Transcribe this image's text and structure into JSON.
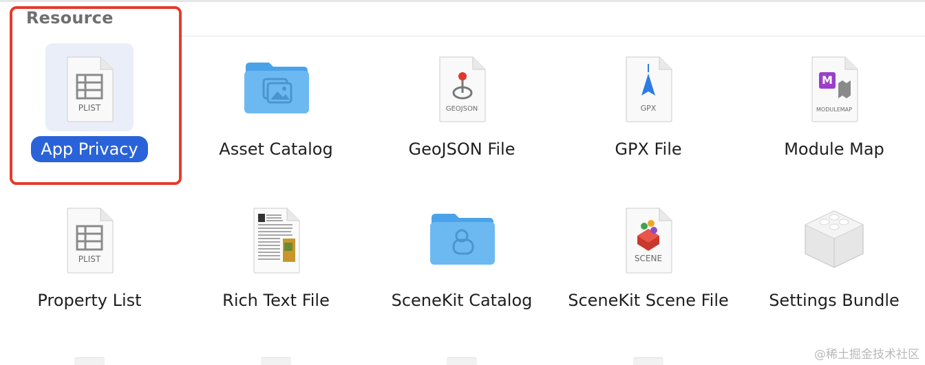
{
  "section": {
    "title": "Resource"
  },
  "templates": [
    {
      "label": "App Privacy",
      "icon": "plist-document-icon",
      "icon_text": "PLIST",
      "selected": true
    },
    {
      "label": "Asset Catalog",
      "icon": "asset-catalog-folder-icon"
    },
    {
      "label": "GeoJSON File",
      "icon": "geojson-document-icon",
      "icon_text": "GEOJSON"
    },
    {
      "label": "GPX File",
      "icon": "gpx-document-icon",
      "icon_text": "GPX"
    },
    {
      "label": "Module Map",
      "icon": "modulemap-document-icon",
      "icon_text": "MODULEMAP",
      "badge_text": "M"
    },
    {
      "label": "Property List",
      "icon": "plist-document-icon",
      "icon_text": "PLIST"
    },
    {
      "label": "Rich Text File",
      "icon": "rich-text-document-icon"
    },
    {
      "label": "SceneKit Catalog",
      "icon": "scenekit-catalog-folder-icon"
    },
    {
      "label": "SceneKit Scene File",
      "icon": "scene-document-icon",
      "icon_text": "SCENE"
    },
    {
      "label": "Settings Bundle",
      "icon": "settings-bundle-brick-icon"
    }
  ],
  "colors": {
    "selection": "#2a63d9",
    "highlight_border": "#e53a2c",
    "folder": "#5fb3f2"
  },
  "watermark": "@稀土掘金技术社区"
}
